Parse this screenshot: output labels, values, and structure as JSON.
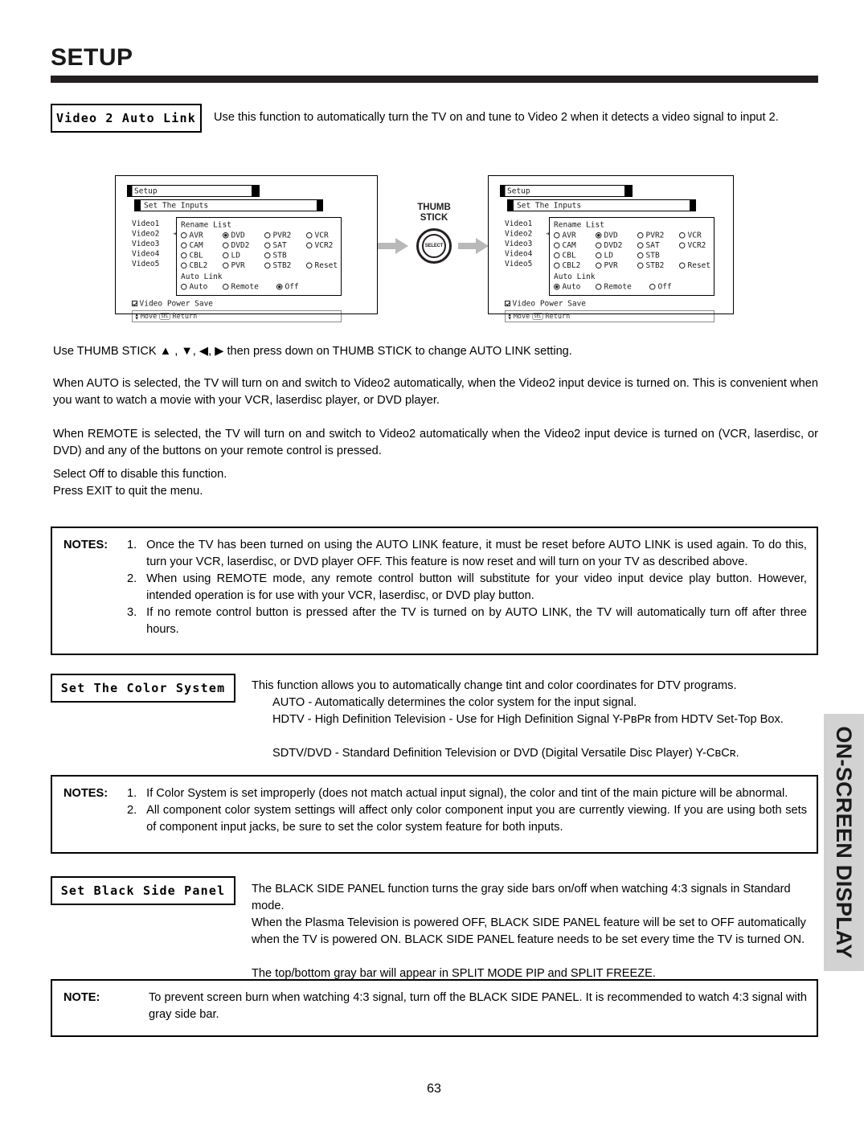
{
  "page": {
    "title": "SETUP",
    "number": "63",
    "side_tab": "ON-SCREEN DISPLAY"
  },
  "sections": {
    "video2_auto_link": {
      "label": "Video 2 Auto Link",
      "description": "Use this function to automatically turn the TV on and tune to Video 2 when it detects a video signal to input 2.",
      "paragraphs": [
        "Use THUMB STICK ▲ , ▼, ◀, ▶ then press down on THUMB STICK to change AUTO LINK setting.",
        "When AUTO  is selected, the TV will turn on and switch to Video2 automatically, when the Video2 input device is turned on. This is convenient when you want to watch a movie with your VCR, laserdisc player, or DVD player.",
        "When REMOTE is selected, the TV will turn on and switch to Video2 automatically when the Video2 input device is turned on (VCR, laserdisc, or DVD) and any of the buttons on your remote control is pressed.",
        "Select Off to disable this function.",
        "Press EXIT to quit the menu."
      ],
      "notes": {
        "label": "NOTES:",
        "items": [
          "Once the TV has been turned on using the AUTO LINK feature, it must be reset before AUTO LINK is used again. To do this, turn your VCR, laserdisc, or DVD player OFF. This feature is now reset and will turn on your TV as described above.",
          "When using REMOTE mode, any remote control button will substitute for your video input device play button. However, intended operation is for use with your VCR, laserdisc, or DVD play button.",
          "If no remote control button is pressed after the TV is turned on by AUTO LINK, the TV will automatically turn off after three hours."
        ],
        "numbers": [
          "1.",
          "2.",
          "3."
        ]
      }
    },
    "color_system": {
      "label": "Set The Color System",
      "lines": [
        "This function allows you to automatically change tint and color coordinates for DTV programs.",
        "AUTO - Automatically determines the color system for the input signal.",
        "HDTV - High Definition Television - Use for High Definition Signal Y-PʙPʀ  from HDTV Set-Top Box.",
        "SDTV/DVD - Standard Definition Television or DVD (Digital Versatile Disc Player) Y-CʙCʀ."
      ],
      "notes": {
        "label": "NOTES:",
        "numbers": [
          "1.",
          "2."
        ],
        "items": [
          "If Color System is set improperly (does not match actual input signal), the color and tint of the main picture will be abnormal.",
          "All component color system settings will affect only color component input you are currently viewing.  If you are using both sets of component input jacks, be sure to set the color system feature for both inputs."
        ]
      }
    },
    "black_side_panel": {
      "label": "Set Black Side Panel",
      "lines": [
        "The BLACK SIDE PANEL function turns the gray side bars on/off when watching 4:3 signals in Standard mode.",
        "When the Plasma Television is powered OFF, BLACK SIDE PANEL feature will be set to OFF automatically when the TV is powered ON.  BLACK SIDE PANEL feature needs to be set every time the TV is turned ON.",
        "The top/bottom gray bar will appear in SPLIT MODE PIP and SPLIT FREEZE."
      ],
      "note": {
        "label": "NOTE:",
        "text": "To prevent screen burn when watching 4:3 signal, turn off the BLACK SIDE PANEL.  It is recommended to watch 4:3 signal with gray side bar."
      }
    }
  },
  "thumb_stick": {
    "caption_line1": "THUMB",
    "caption_line2": "STICK",
    "knob_label": "SELECT"
  },
  "osd": {
    "title": "Setup",
    "subtitle": "Set The Inputs",
    "video_inputs": [
      "Video1",
      "Video2",
      "Video3",
      "Video4",
      "Video5"
    ],
    "selected_input_index": 1,
    "input_marker": "➔",
    "rename_list_title": "Rename List",
    "rename_options": [
      "AVR",
      "DVD",
      "PVR2",
      "VCR",
      "CAM",
      "DVD2",
      "SAT",
      "VCR2",
      "CBL",
      "LD",
      "STB",
      "",
      "CBL2",
      "PVR",
      "STB2",
      "Reset"
    ],
    "rename_selected": "DVD",
    "auto_link_title": "Auto Link",
    "auto_link_options": [
      "Auto",
      "Remote",
      "Off"
    ],
    "power_save_label": "Video Power Save",
    "power_save_checked": true,
    "foot_move": "Move",
    "foot_sel_key": "SEL",
    "foot_return": "Return",
    "left_panel_autolink_selected": "Off",
    "right_panel_autolink_selected": "Auto"
  }
}
